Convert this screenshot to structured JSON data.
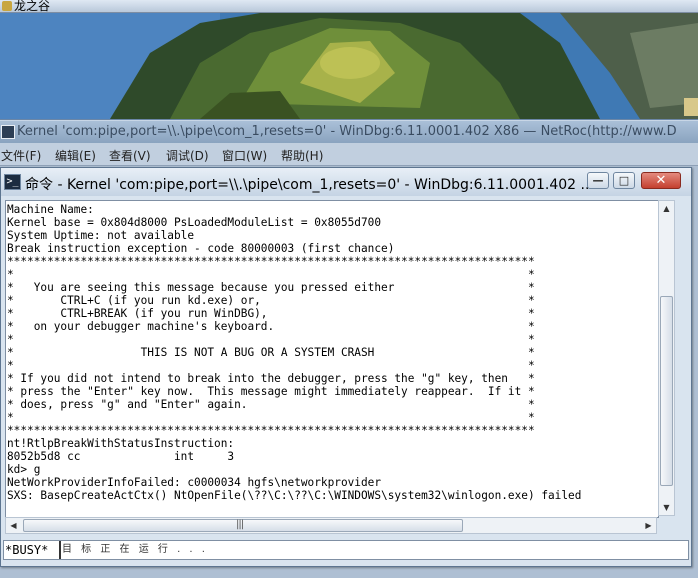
{
  "background_window": {
    "title": "龙之谷"
  },
  "main_window": {
    "title": "Kernel 'com:pipe,port=\\\\.\\pipe\\com_1,resets=0' - WinDbg:6.11.0001.402 X86 — NetRoc(http://www.D"
  },
  "menu": {
    "items": [
      {
        "label": "文件(F)"
      },
      {
        "label": "编辑(E)"
      },
      {
        "label": "查看(V)"
      },
      {
        "label": "调试(D)"
      },
      {
        "label": "窗口(W)"
      },
      {
        "label": "帮助(H)"
      }
    ]
  },
  "command_window": {
    "title": "命令 - Kernel 'com:pipe,port=\\\\.\\pipe\\com_1,resets=0' - WinDbg:6.11.0001.402 ...",
    "icon_glyph": ">_",
    "minimize_glyph": "—",
    "maximize_glyph": "□",
    "close_glyph": "✕",
    "output_lines": [
      "Machine Name:",
      "Kernel base = 0x804d8000 PsLoadedModuleList = 0x8055d700",
      "System Uptime: not available",
      "Break instruction exception - code 80000003 (first chance)",
      "*******************************************************************************",
      "*                                                                             *",
      "*   You are seeing this message because you pressed either                    *",
      "*       CTRL+C (if you run kd.exe) or,                                        *",
      "*       CTRL+BREAK (if you run WinDBG),                                       *",
      "*   on your debugger machine's keyboard.                                      *",
      "*                                                                             *",
      "*                   THIS IS NOT A BUG OR A SYSTEM CRASH                       *",
      "*                                                                             *",
      "* If you did not intend to break into the debugger, press the \"g\" key, then   *",
      "* press the \"Enter\" key now.  This message might immediately reappear.  If it *",
      "* does, press \"g\" and \"Enter\" again.                                          *",
      "*                                                                             *",
      "*******************************************************************************",
      "nt!RtlpBreakWithStatusInstruction:",
      "8052b5d8 cc              int     3",
      "kd> g",
      "NetWorkProviderInfoFailed: c0000034 hgfs\\networkprovider",
      "SXS: BasepCreateActCtx() NtOpenFile(\\??\\C:\\??\\C:\\WINDOWS\\system32\\winlogon.exe) failed"
    ],
    "scroll_up_glyph": "▲",
    "scroll_down_glyph": "▼",
    "scroll_left_glyph": "◀",
    "scroll_right_glyph": "▶",
    "hscroll_grip": "|||",
    "status_prompt": "*BUSY*",
    "input_text": "目 标 正 在 运 行 . . ."
  }
}
